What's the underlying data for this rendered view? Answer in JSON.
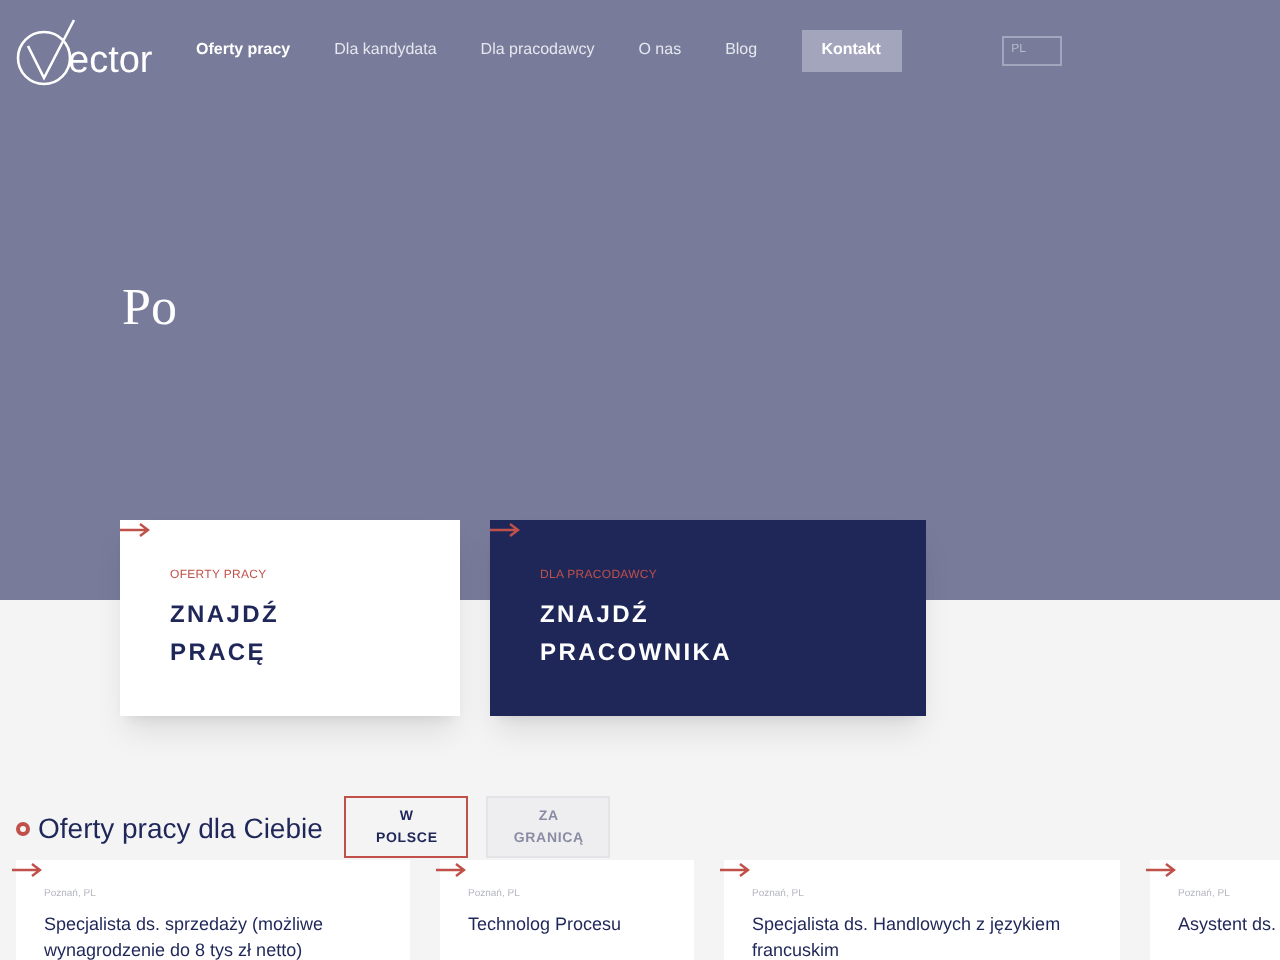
{
  "logo": {
    "text": "ector"
  },
  "nav": [
    {
      "label": "Oferty pracy",
      "selected": true
    },
    {
      "label": "Dla kandydata",
      "selected": false
    },
    {
      "label": "Dla pracodawcy",
      "selected": false
    },
    {
      "label": "O nas",
      "selected": false
    },
    {
      "label": "Blog",
      "selected": false
    }
  ],
  "contact_button": "Kontakt",
  "language_field": {
    "placeholder": "PL"
  },
  "hero": {
    "title": "Po"
  },
  "tiles": [
    {
      "kind": "light",
      "eyebrow": "OFERTY PRACY",
      "title_lines": [
        "ZNAJDŹ",
        "PRACĘ"
      ]
    },
    {
      "kind": "dark",
      "eyebrow": "DLA PRACODAWCY",
      "title_lines": [
        "ZNAJDŹ",
        "PRACOWNIKA"
      ]
    }
  ],
  "offers": {
    "heading": "Oferty pracy dla Ciebie",
    "tabs": [
      {
        "lines": [
          "W",
          "POLSCE"
        ],
        "selected": true
      },
      {
        "lines": [
          "ZA",
          "GRANICĄ"
        ],
        "selected": false
      }
    ],
    "jobs": [
      {
        "location": "Poznań, PL",
        "title": "Specjalista ds. sprzedaży (możliwe wynagrodzenie do 8 tys zł netto)"
      },
      {
        "location": "Poznań, PL",
        "title": "Technolog Procesu"
      },
      {
        "location": "Poznań, PL",
        "title": "Specjalista ds. Handlowych z językiem francuskim"
      },
      {
        "location": "Poznań, PL",
        "title": "Asystent ds."
      }
    ]
  }
}
